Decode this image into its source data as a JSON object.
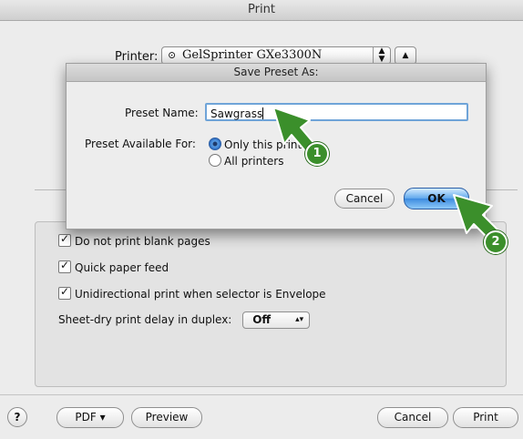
{
  "print_dialog": {
    "title": "Print",
    "printer_label": "Printer:",
    "printer_value": "GelSprinter GXe3300N",
    "options": [
      "Do not print blank pages",
      "Quick paper feed",
      "Unidirectional print when selector is Envelope"
    ],
    "delay_label": "Sheet-dry print delay in duplex:",
    "delay_value": "Off",
    "help_label": "?",
    "pdf_label": "PDF ▾",
    "preview_label": "Preview",
    "cancel_label": "Cancel",
    "print_label": "Print"
  },
  "sheet": {
    "title": "Save Preset As:",
    "name_label": "Preset Name:",
    "name_value": "Sawgrass",
    "available_label": "Preset Available For:",
    "radio_options": [
      "Only this printer",
      "All printers"
    ],
    "selected_option": "Only this printer",
    "cancel_label": "Cancel",
    "ok_label": "OK"
  },
  "annotations": {
    "step1": "1",
    "step2": "2",
    "arrow_color": "#3b8f2b"
  }
}
